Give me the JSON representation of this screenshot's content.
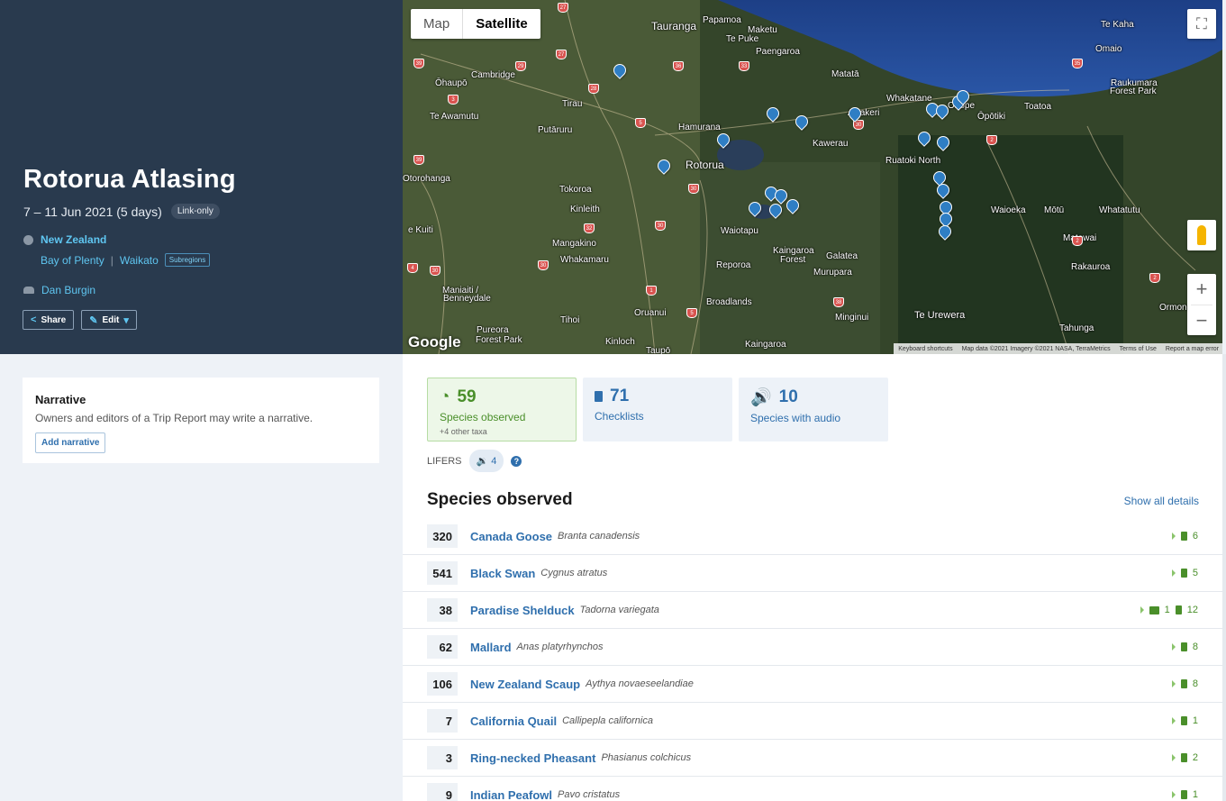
{
  "trip": {
    "title": "Rotorua Atlasing",
    "dates": "7 – 11 Jun 2021 (5 days)",
    "visibility": "Link-only",
    "country": "New Zealand",
    "region_1": "Bay of Plenty",
    "region_sep": "|",
    "region_2": "Waikato",
    "subregions_badge": "Subregions",
    "owner": "Dan Burgin",
    "share_label": "Share",
    "edit_label": "Edit"
  },
  "map": {
    "tab_map": "Map",
    "tab_satellite": "Satellite",
    "google": "Google",
    "attr_shortcuts": "Keyboard shortcuts",
    "attr_data": "Map data ©2021 Imagery ©2021 NASA, TerraMetrics",
    "attr_terms": "Terms of Use",
    "attr_report": "Report a map error",
    "places": [
      "Tauranga",
      "Papamoa",
      "Maketu",
      "Te Puke",
      "Paengaroa",
      "Matata",
      "Whakatane",
      "Ohope",
      "Opotiki",
      "Toatoa",
      "Te Kaha",
      "Omaio",
      "Raukumara Forest Park",
      "Cambridge",
      "Ohaupo",
      "Tirau",
      "Te Awamutu",
      "Putaruru",
      "Hamurana",
      "Rotorua",
      "Kawerau",
      "Awakeri",
      "Ruatoki North",
      "Otorohanga",
      "Tokoroa",
      "Kinleith",
      "Waiotapu",
      "Kaingaroa Forest",
      "Galatea",
      "Waioeka",
      "Motu",
      "Whatatutu",
      "Matawai",
      "Rakauroa",
      "Te Kuiti",
      "Mangakino",
      "Whakamaru",
      "Reporoa",
      "Murupara",
      "Maniaiti / Benneydale",
      "Oruanui",
      "Broadlands",
      "Minginui",
      "Te Urewera",
      "Tahunga",
      "Ormond",
      "Pureora Forest Park",
      "Tihoi",
      "Kinloch",
      "Taupo",
      "Kaingaroa"
    ],
    "zoom_in": "+",
    "zoom_out": "−",
    "fullscreen": "⛶"
  },
  "narrative": {
    "title": "Narrative",
    "text": "Owners and editors of a Trip Report may write a narrative.",
    "button": "Add narrative"
  },
  "stats": {
    "species_count": "59",
    "species_label": "Species observed",
    "species_sub": "+4 other taxa",
    "checklists_count": "71",
    "checklists_label": "Checklists",
    "audio_count": "10",
    "audio_label": "Species with audio"
  },
  "lifers": {
    "label": "LIFERS",
    "count": "4",
    "help": "?"
  },
  "species_section": {
    "heading": "Species observed",
    "show_all": "Show all details"
  },
  "species": [
    {
      "count": "320",
      "common": "Canada Goose",
      "sci": "Branta canadensis",
      "photos": "",
      "checklists": "6"
    },
    {
      "count": "541",
      "common": "Black Swan",
      "sci": "Cygnus atratus",
      "photos": "",
      "checklists": "5"
    },
    {
      "count": "38",
      "common": "Paradise Shelduck",
      "sci": "Tadorna variegata",
      "photos": "1",
      "checklists": "12"
    },
    {
      "count": "62",
      "common": "Mallard",
      "sci": "Anas platyrhynchos",
      "photos": "",
      "checklists": "8"
    },
    {
      "count": "106",
      "common": "New Zealand Scaup",
      "sci": "Aythya novaeseelandiae",
      "photos": "",
      "checklists": "8"
    },
    {
      "count": "7",
      "common": "California Quail",
      "sci": "Callipepla californica",
      "photos": "",
      "checklists": "1"
    },
    {
      "count": "3",
      "common": "Ring-necked Pheasant",
      "sci": "Phasianus colchicus",
      "photos": "",
      "checklists": "2"
    },
    {
      "count": "9",
      "common": "Indian Peafowl",
      "sci": "Pavo cristatus",
      "photos": "",
      "checklists": "1"
    }
  ],
  "icons": {
    "globe": "globe-icon",
    "people": "people-icon",
    "share": "share-icon",
    "edit": "edit-icon",
    "species": "species-icon",
    "checklist": "checklist-icon",
    "audio": "audio-icon",
    "photo": "photo-icon"
  },
  "colors": {
    "header_bg": "#293a4e",
    "link": "#2f6fad",
    "green": "#4a8f2a",
    "light_link": "#5fc6f1"
  }
}
